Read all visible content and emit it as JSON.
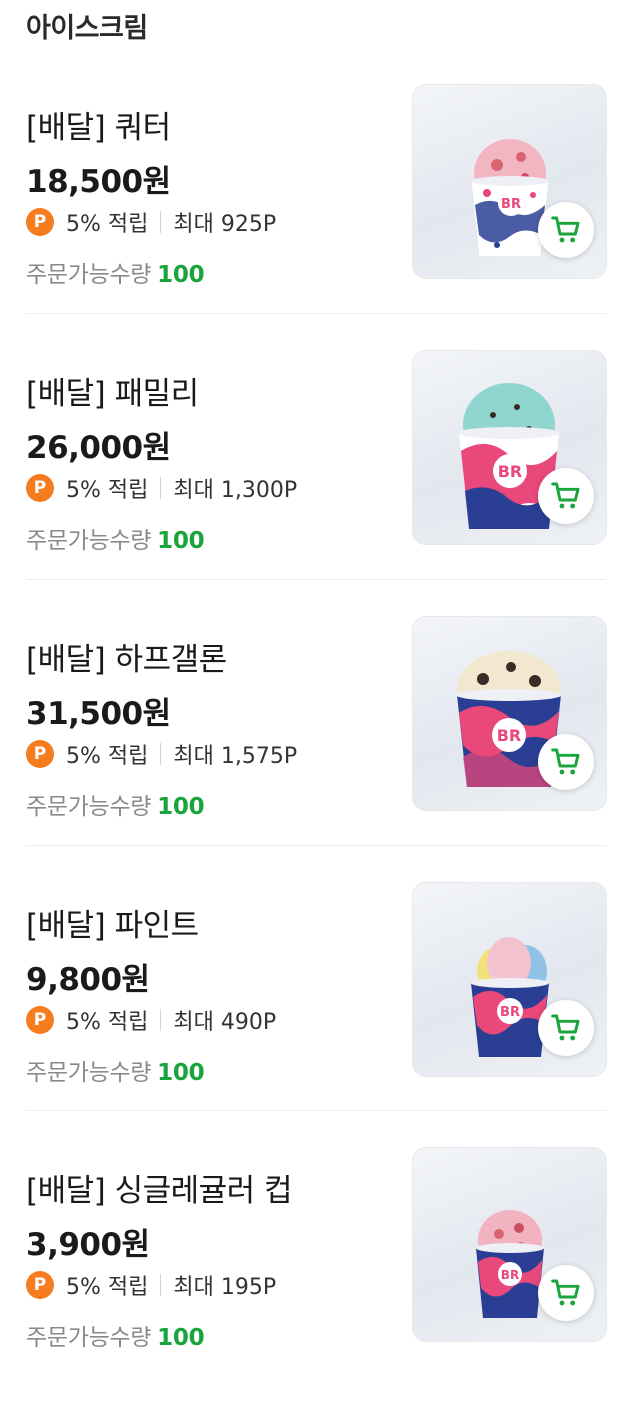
{
  "section": {
    "title": "아이스크림"
  },
  "colors": {
    "accent_green": "#1aa43c",
    "point_orange": "#f57c1f",
    "cup_navy": "#243a8f",
    "cup_pink": "#e9487a"
  },
  "products": [
    {
      "name": "[배달] 쿼터",
      "price": "18,500원",
      "point_badge": "P",
      "point_rate": "5% 적립",
      "point_max": "최대 925P",
      "qty_label": "주문가능수량",
      "qty_value": "100",
      "cart_icon": "cart-icon",
      "scoop_color": "#f2b6c3"
    },
    {
      "name": "[배달] 패밀리",
      "price": "26,000원",
      "point_badge": "P",
      "point_rate": "5% 적립",
      "point_max": "최대 1,300P",
      "qty_label": "주문가능수량",
      "qty_value": "100",
      "cart_icon": "cart-icon",
      "scoop_color": "#8fd6cf"
    },
    {
      "name": "[배달] 하프갤론",
      "price": "31,500원",
      "point_badge": "P",
      "point_rate": "5% 적립",
      "point_max": "최대 1,575P",
      "qty_label": "주문가능수량",
      "qty_value": "100",
      "cart_icon": "cart-icon",
      "scoop_color": "#f1e8cf"
    },
    {
      "name": "[배달] 파인트",
      "price": "9,800원",
      "point_badge": "P",
      "point_rate": "5% 적립",
      "point_max": "최대 490P",
      "qty_label": "주문가능수량",
      "qty_value": "100",
      "cart_icon": "cart-icon",
      "scoop_color": "#f3c2cf"
    },
    {
      "name": "[배달] 싱글레귤러 컵",
      "price": "3,900원",
      "point_badge": "P",
      "point_rate": "5% 적립",
      "point_max": "최대 195P",
      "qty_label": "주문가능수량",
      "qty_value": "100",
      "cart_icon": "cart-icon",
      "scoop_color": "#f0b3bf"
    }
  ]
}
